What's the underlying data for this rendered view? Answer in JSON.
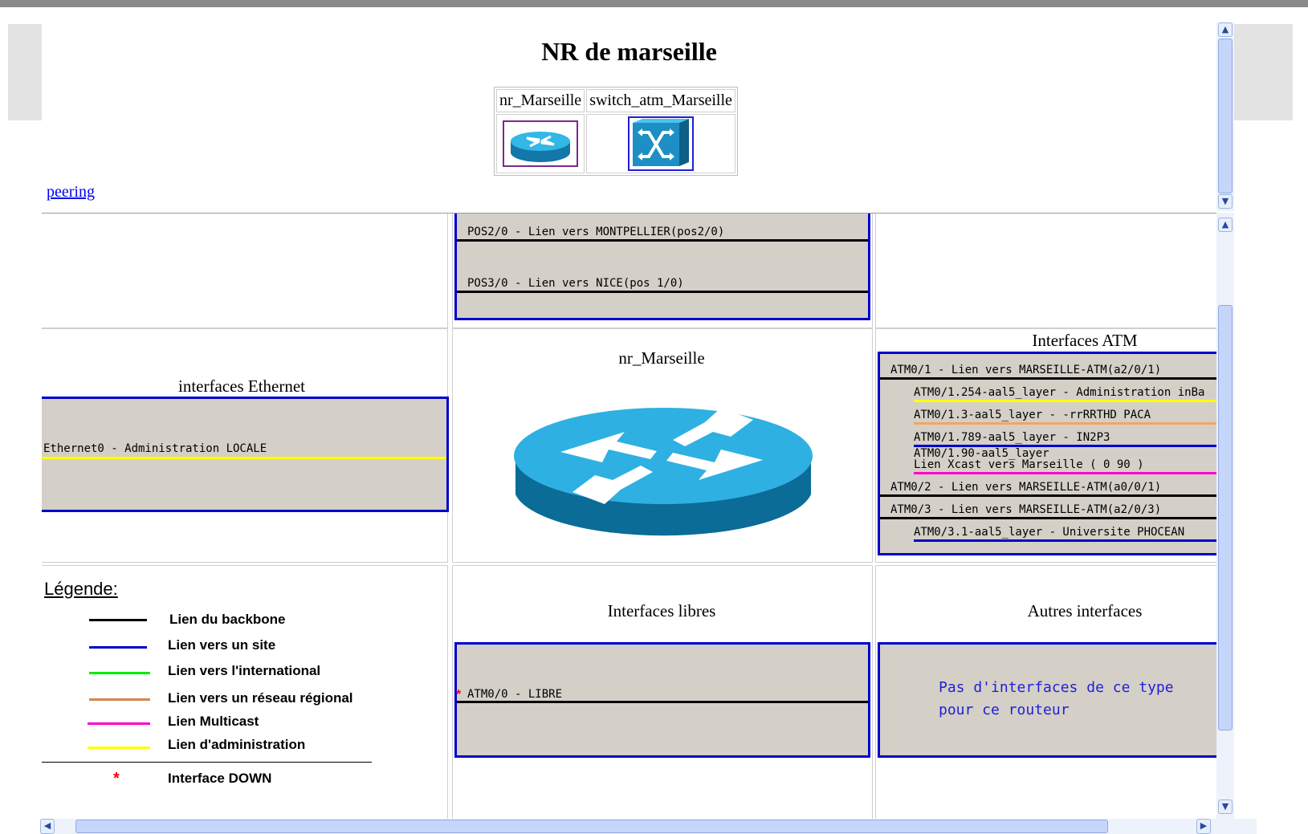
{
  "page": {
    "title": "NR de marseille",
    "peering_link": "peering"
  },
  "devices": [
    {
      "name": "nr_Marseille"
    },
    {
      "name": "switch_atm_Marseille"
    }
  ],
  "top_frame": {
    "pos_links": [
      {
        "label": "POS2/0 - Lien vers MONTPELLIER(pos2/0)",
        "color": "#000000"
      },
      {
        "label": "POS3/0 - Lien vers NICE(pos 1/0)",
        "color": "#000000"
      }
    ]
  },
  "ethernet": {
    "title": "interfaces Ethernet",
    "interfaces": [
      {
        "label": "Ethernet0 - Administration LOCALE",
        "color": "#ffff00"
      }
    ]
  },
  "router": {
    "label": "nr_Marseille"
  },
  "atm": {
    "title": "Interfaces ATM",
    "interfaces": [
      {
        "label": "ATM0/1 - Lien vers MARSEILLE-ATM(a2/0/1)",
        "color": "#000000",
        "indent": false
      },
      {
        "label": "ATM0/1.254-aal5_layer - Administration inBa",
        "color": "#ffff00",
        "indent": true
      },
      {
        "label": "ATM0/1.3-aal5_layer - -rrRRTHD PACA",
        "color": "#f4a460",
        "indent": true
      },
      {
        "label": "ATM0/1.789-aal5_layer - IN2P3",
        "color": "#0000cc",
        "indent": true
      },
      {
        "label": "ATM0/1.90-aal5_layer",
        "label2": "Lien Xcast vers Marseille ( 0 90 )",
        "color": "#ff00cc",
        "indent": true
      },
      {
        "label": "ATM0/2 - Lien vers MARSEILLE-ATM(a0/0/1)",
        "color": "#000000",
        "indent": false
      },
      {
        "label": "ATM0/3 - Lien vers MARSEILLE-ATM(a2/0/3)",
        "color": "#000000",
        "indent": false
      },
      {
        "label": "ATM0/3.1-aal5_layer - Universite PHOCEAN",
        "color": "#0000cc",
        "indent": true
      }
    ]
  },
  "legend": {
    "title": "Légende:",
    "items": [
      {
        "label": "Lien du backbone",
        "color": "#000000"
      },
      {
        "label": "Lien vers un site",
        "color": "#0000cc"
      },
      {
        "label": "Lien vers l'international",
        "color": "#00ee00"
      },
      {
        "label": "Lien vers un réseau régional",
        "color": "#d2874d"
      },
      {
        "label": "Lien Multicast",
        "color": "#ff00cc"
      },
      {
        "label": "Lien d'administration",
        "color": "#ffff00"
      }
    ],
    "down_symbol": "*",
    "down_label": "Interface DOWN"
  },
  "libres": {
    "title": "Interfaces libres",
    "interfaces": [
      {
        "label": "ATM0/0 - LIBRE",
        "color": "#000000",
        "down": true
      }
    ]
  },
  "autres": {
    "title": "Autres interfaces",
    "empty_line1": "Pas d'interfaces de ce type",
    "empty_line2": "pour ce routeur"
  },
  "colors": {
    "border_blue": "#0000cc",
    "panel_gray": "#d4d0c8",
    "link_blue": "#0000ee",
    "down_red": "#ff0000"
  }
}
